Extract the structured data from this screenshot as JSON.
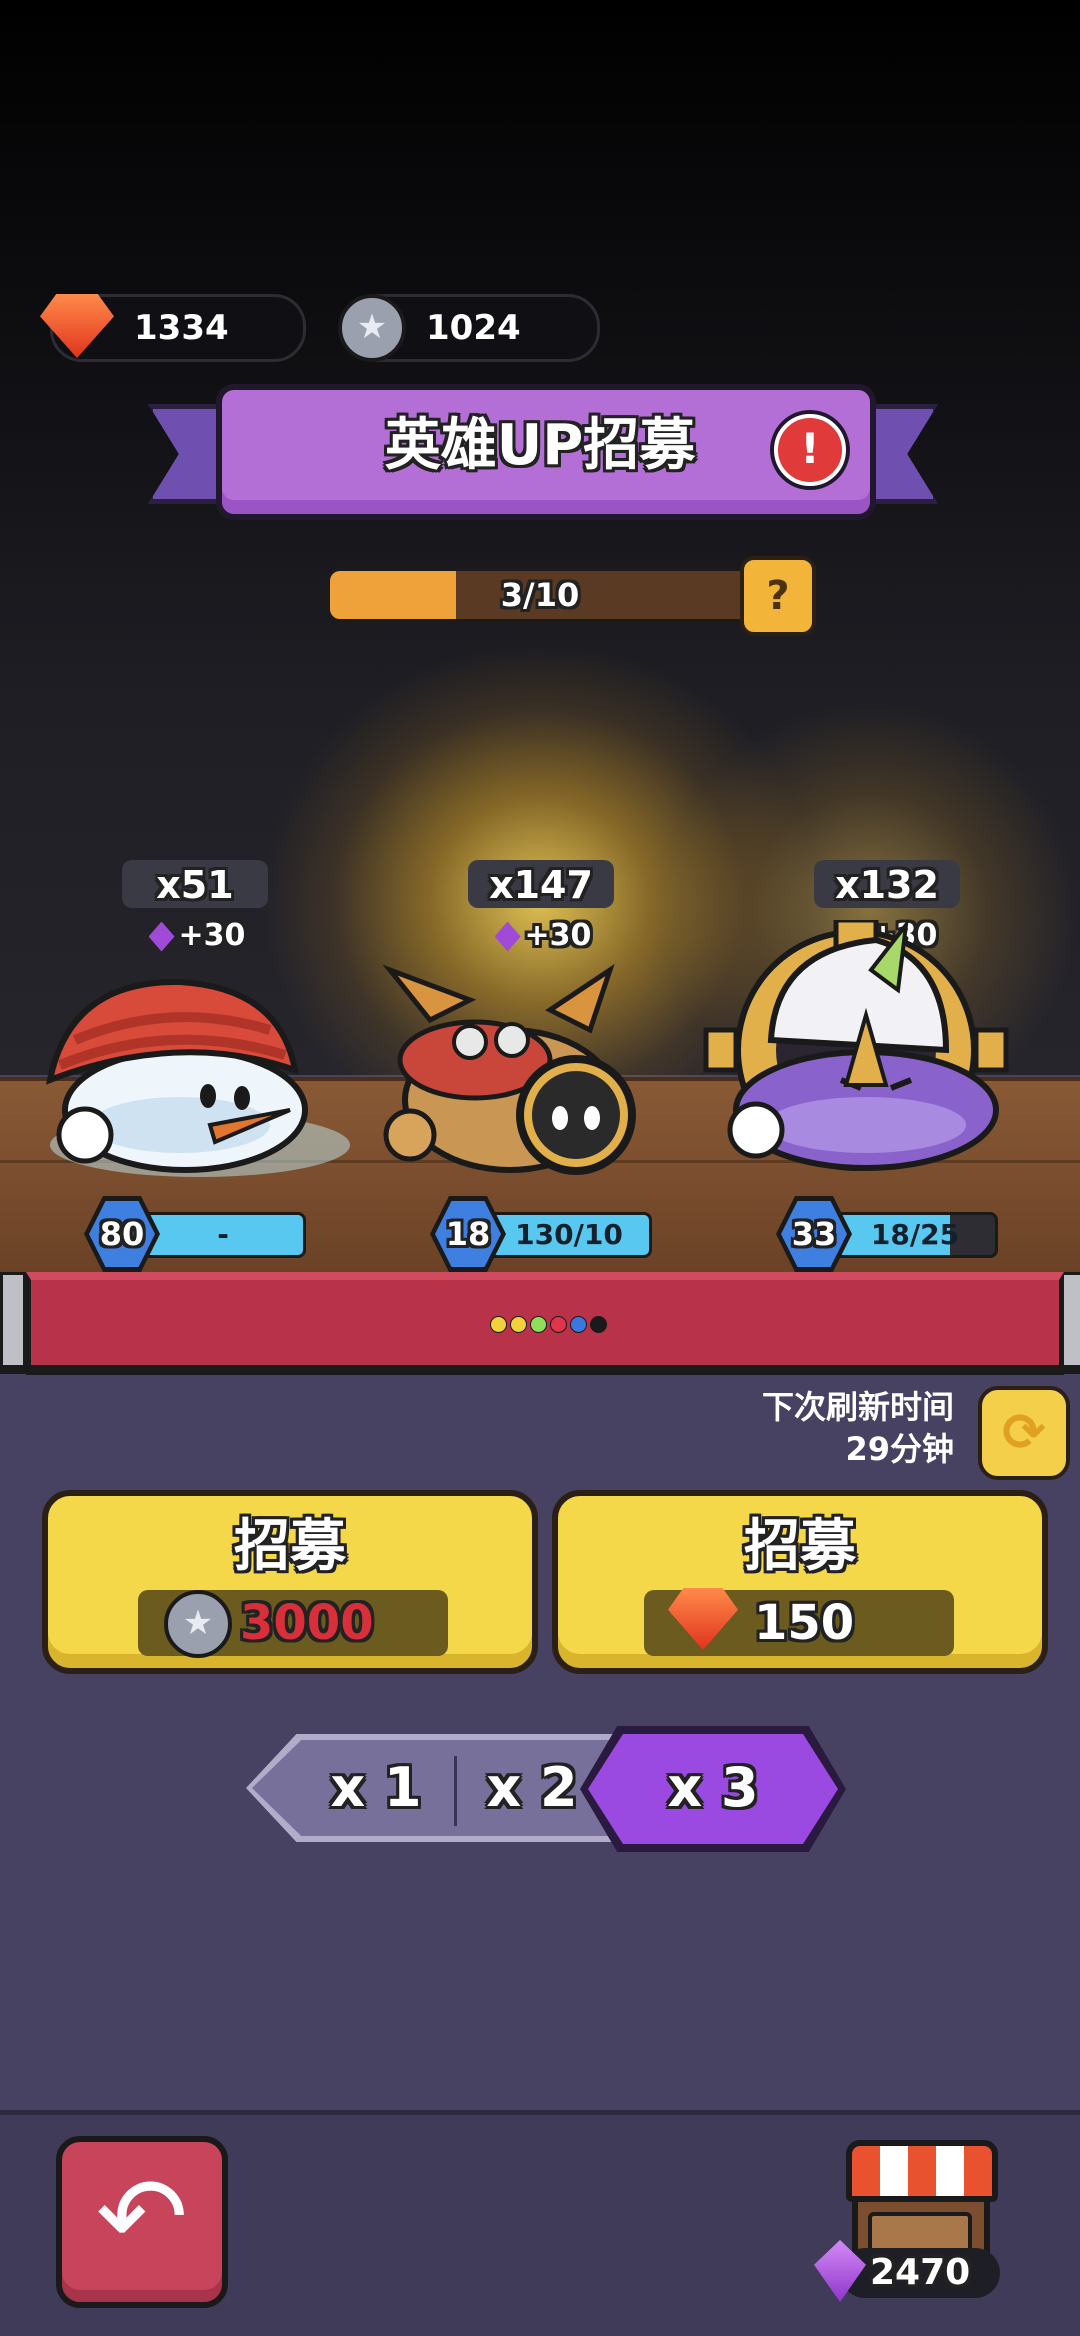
{
  "currency": {
    "rubies": "1334",
    "coins": "1024"
  },
  "banner": {
    "title": "英雄UP招募",
    "info_icon": "exclamation-icon"
  },
  "progress": {
    "label": "3/10",
    "value": 3,
    "max": 10,
    "help": "?"
  },
  "heroes": [
    {
      "name_icon": "snowman-hero",
      "count": "x51",
      "bonus": "+30",
      "level": "80",
      "shards": "-",
      "fill": 1.0
    },
    {
      "name_icon": "goggles-beetle-hero",
      "count": "x147",
      "bonus": "+30",
      "level": "18",
      "shards": "130/10",
      "fill": 1.0
    },
    {
      "name_icon": "gear-knight-hero",
      "count": "x132",
      "bonus": "+30",
      "level": "33",
      "shards": "18/25",
      "fill": 0.72
    }
  ],
  "page_dots": {
    "colors": [
      "#f2d23a",
      "#f2d23a",
      "#8ee05a",
      "#e0344a",
      "#3a78e0",
      "#1a1a1a"
    ]
  },
  "refresh": {
    "line1": "下次刷新时间",
    "line2": "29分钟"
  },
  "recruit_buttons": [
    {
      "title": "招募",
      "currency_icon": "coin-icon",
      "price": "3000",
      "price_color": "#d8303a"
    },
    {
      "title": "招募",
      "currency_icon": "ruby-icon",
      "price": "150",
      "price_color": "#ffffff"
    }
  ],
  "multiplier": {
    "options": [
      "x 1",
      "x 2",
      "x 3"
    ],
    "selected": "x 3"
  },
  "shop": {
    "gems": "2470"
  },
  "colors": {
    "accent_purple": "#9a4ae0",
    "recruit_yellow": "#f5d84a",
    "back_red": "#c8445a"
  }
}
